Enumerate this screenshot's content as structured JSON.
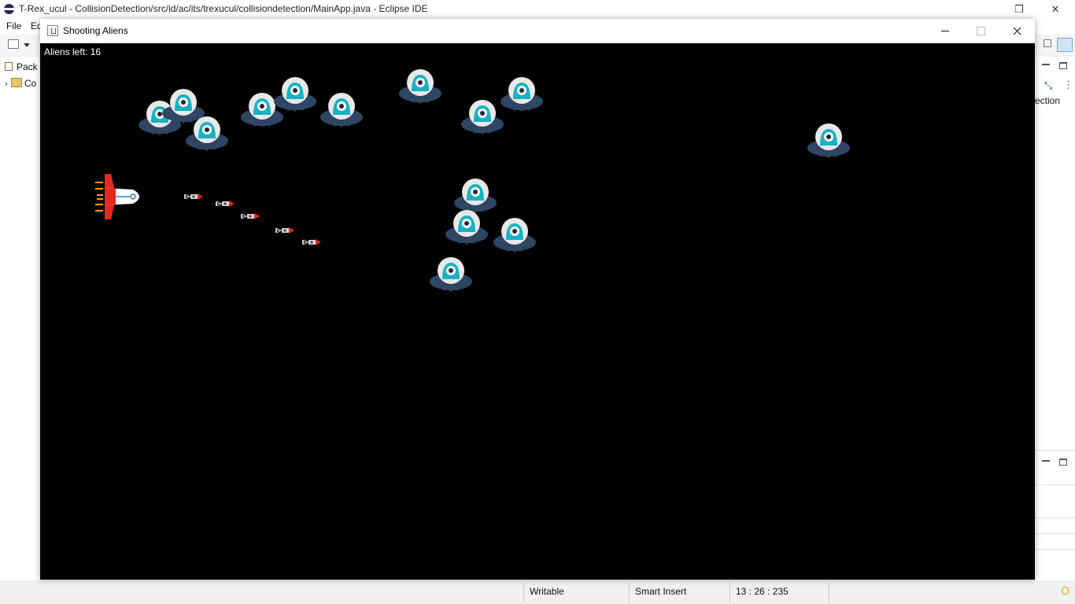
{
  "eclipse": {
    "window_title": "T-Rex_ucul - CollisionDetection/src/id/ac/its/trexucul/collisiondetection/MainApp.java - Eclipse IDE",
    "menu": {
      "file": "File",
      "edit": "Ed"
    },
    "package_explorer_tab": "Pack",
    "project_row": "Co",
    "outline_label": "ection",
    "status": {
      "writable": "Writable",
      "insert_mode": "Smart Insert",
      "position": "13 : 26 : 235"
    }
  },
  "game_window": {
    "title": "Shooting Aliens",
    "aliens_left_label": "Aliens left: 16",
    "aliens_count": 16,
    "colors": {
      "background": "#000000",
      "ufo_body": "#2e4664",
      "ufo_glow": "#ff6b1a",
      "dome": "#e8e8e8",
      "alien": "#1ab1c2",
      "ship_hull": "#ffffff",
      "ship_accent": "#e8281e",
      "ship_line": "#3a7bc8"
    },
    "missile_count": 5
  }
}
